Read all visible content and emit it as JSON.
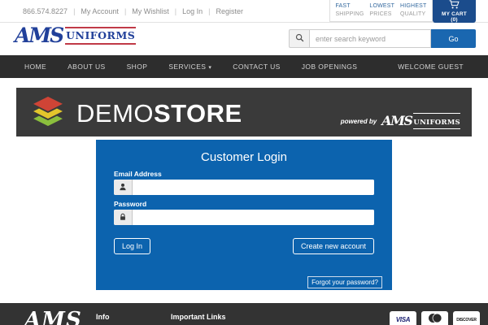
{
  "topbar": {
    "phone": "866.574.8227",
    "separator": "|",
    "links": [
      "My Account",
      "My Wishlist",
      "Log In",
      "Register"
    ],
    "badges": [
      {
        "line1": "FAST",
        "line2": "SHIPPING"
      },
      {
        "line1": "LOWEST",
        "line2": "PRICES"
      },
      {
        "line1": "HIGHEST",
        "line2": "QUALITY"
      }
    ],
    "cart_label": "MY CART (0)"
  },
  "header": {
    "logo_script": "AMS",
    "logo_word": "UNIFORMS",
    "search_placeholder": "enter search keyword",
    "search_value": "",
    "search_button": "Go"
  },
  "nav": {
    "items": [
      "HOME",
      "ABOUT US",
      "SHOP",
      "SERVICES",
      "CONTACT US",
      "JOB OPENINGS"
    ],
    "caret": "▾",
    "welcome": "WELCOME GUEST"
  },
  "banner": {
    "title_light": "DEMO",
    "title_bold": "STORE",
    "powered_by": "powered by",
    "powered_logo_script": "AMS",
    "powered_logo_word": "UNIFORMS"
  },
  "login": {
    "title": "Customer Login",
    "email_label": "Email Address",
    "email_value": "",
    "password_label": "Password",
    "password_value": "",
    "login_button": "Log In",
    "create_button": "Create new account",
    "forgot_link": "Forgot your password?"
  },
  "footer": {
    "logo_script": "AMS",
    "info_heading": "Info",
    "links_heading": "Important Links",
    "payments": {
      "visa": "VISA",
      "discover": "DISCOVER"
    }
  },
  "colors": {
    "accent_blue": "#33689e",
    "cart_navy": "#1b4c8c",
    "go_button_blue": "#1a67b0",
    "panel_blue": "#0c63ae",
    "nav_bar": "#2d2d2d",
    "banner_bg": "#3a3a3a",
    "footer_bg": "#333333",
    "logo_blue": "#21409a",
    "logo_red": "#c03a47",
    "layers_red": "#cf4436",
    "layers_yellow": "#e3c52c",
    "layers_green": "#8bbf3d"
  }
}
